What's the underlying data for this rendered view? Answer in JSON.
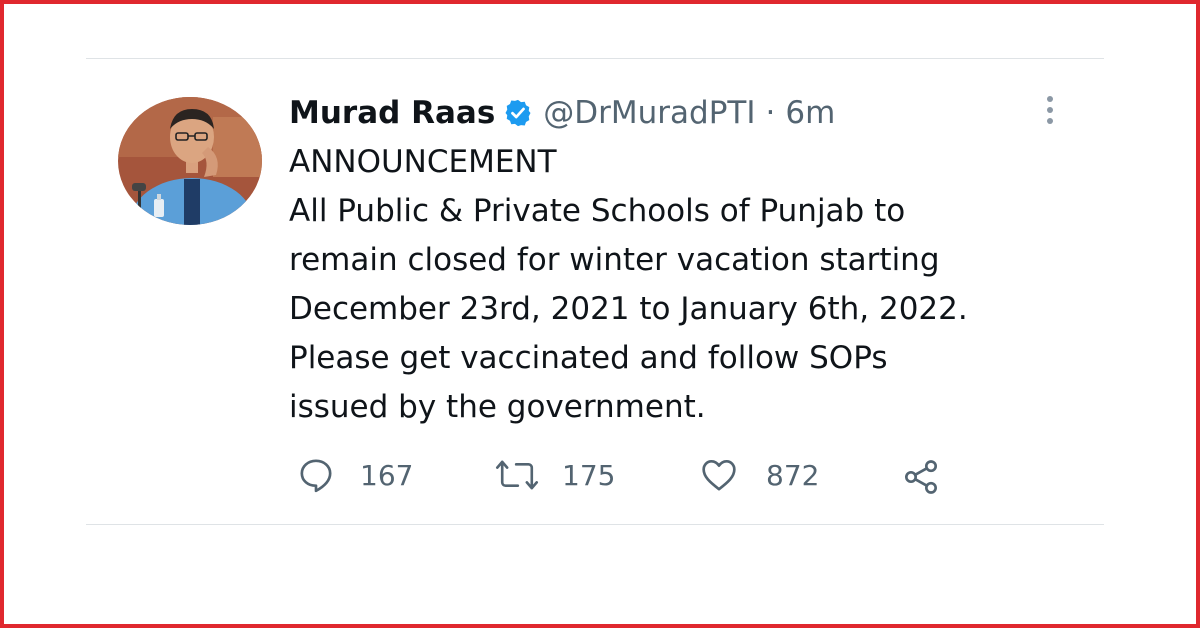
{
  "tweet": {
    "author_name": "Murad Raas",
    "handle": "@DrMuradPTI",
    "separator": "·",
    "time": "6m",
    "lines": [
      "ANNOUNCEMENT",
      "All Public & Private Schools of Punjab to",
      "remain closed for winter vacation starting",
      "December 23rd, 2021 to January 6th, 2022.",
      "Please get vaccinated and follow SOPs",
      "issued by the government."
    ],
    "replies": "167",
    "retweets": "175",
    "likes": "872"
  },
  "icons": {
    "verified": "verified-badge-icon",
    "more": "more-vertical-icon",
    "reply": "reply-icon",
    "retweet": "retweet-icon",
    "like": "heart-icon",
    "share": "share-icon"
  },
  "colors": {
    "frame": "#e0282e",
    "verified": "#1d9bf0",
    "text": "#0f1419",
    "secondary": "#536471"
  }
}
